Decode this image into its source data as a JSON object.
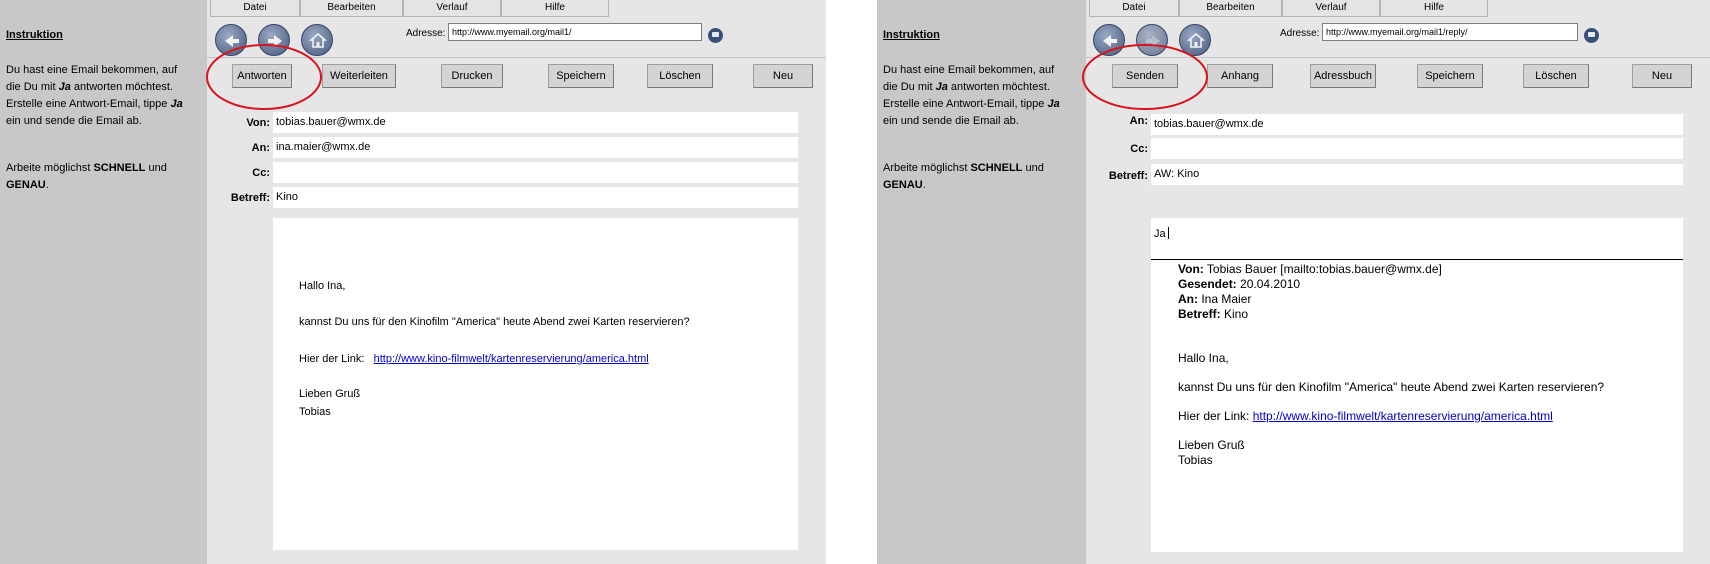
{
  "left": {
    "sidebar": {
      "title": "Instruktion",
      "lines": [
        "Du hast eine Email bekommen, auf",
        "die Du mit",
        "Ja",
        "antworten möchtest.",
        "Erstelle eine Antwort-Email, tippe",
        "Ja",
        "ein und sende die Email ab."
      ],
      "line2_pre": "Arbeite möglichst",
      "line2_b1": "SCHNELL",
      "line2_mid": "und",
      "line2_b2": "GENAU",
      "line2_end": "."
    },
    "menu": [
      "Datei",
      "Bearbeiten",
      "Verlauf",
      "Hilfe"
    ],
    "address_label": "Adresse:",
    "address_value": "http://www.myemail.org/mail1/",
    "buttons": [
      "Antworten",
      "Weiterleiten",
      "Drucken",
      "Speichern",
      "Löschen",
      "Neu"
    ],
    "fields": {
      "von_label": "Von:",
      "von_value": "tobias.bauer@wmx.de",
      "an_label": "An:",
      "an_value": "ina.maier@wmx.de",
      "cc_label": "Cc:",
      "cc_value": "",
      "betreff_label": "Betreff:",
      "betreff_value": "Kino"
    },
    "body": {
      "greeting": "Hallo Ina,",
      "question": "kannst Du uns für den Kinofilm \"America\" heute Abend zwei Karten reservieren?",
      "link_prefix": "Hier der Link:",
      "link": "http://www.kino-filmwelt/kartenreservierung/america.html",
      "closing": "Lieben Gruß",
      "signature": "Tobias"
    }
  },
  "right": {
    "sidebar": {
      "title": "Instruktion"
    },
    "menu": [
      "Datei",
      "Bearbeiten",
      "Verlauf",
      "Hilfe"
    ],
    "address_label": "Adresse:",
    "address_value": "http://www.myemail.org/mail1/reply/",
    "buttons": [
      "Senden",
      "Anhang",
      "Adressbuch",
      "Speichern",
      "Löschen",
      "Neu"
    ],
    "fields": {
      "an_label": "An:",
      "an_value": "tobias.bauer@wmx.de",
      "cc_label": "Cc:",
      "cc_value": "",
      "betreff_label": "Betreff:",
      "betreff_value": "AW: Kino"
    },
    "reply_text": "Ja",
    "quote": {
      "von_label": "Von:",
      "von_value": "Tobias Bauer [mailto:tobias.bauer@wmx.de]",
      "gesendet_label": "Gesendet:",
      "gesendet_value": "20.04.2010",
      "an_label": "An:",
      "an_value": "Ina Maier",
      "betreff_label": "Betreff:",
      "betreff_value": "Kino"
    },
    "body": {
      "greeting": "Hallo Ina,",
      "question": "kannst Du uns für den Kinofilm \"America\" heute Abend zwei Karten reservieren?",
      "link_prefix": "Hier der Link:",
      "link": "http://www.kino-filmwelt/kartenreservierung/america.html",
      "closing": "Lieben Gruß",
      "signature": "Tobias"
    }
  },
  "colors": {
    "highlight_ellipse": "#d9141b",
    "sidebar_bg": "#c8c8c8",
    "browser_bg": "#e6e6e6",
    "link": "#0000cc"
  }
}
